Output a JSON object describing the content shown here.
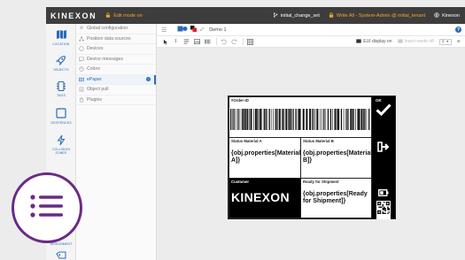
{
  "topbar": {
    "logo": "KINEXON",
    "edit_mode": "Edit mode on",
    "branch": "initial_change_set",
    "write_access": "Write All - System-Admin @ initial_tenant",
    "user": "Kinexon"
  },
  "iconnav": {
    "items": [
      {
        "label": "LOCATION",
        "icon": "map-icon",
        "active": true
      },
      {
        "label": "OBJECTS",
        "icon": "rocket-icon",
        "active": false
      },
      {
        "label": "TAGS",
        "icon": "chip-icon",
        "active": false
      },
      {
        "label": "GEOFENCES",
        "icon": "square-icon",
        "active": false
      },
      {
        "label": "COLLISION ZONES",
        "icon": "bolt-icon",
        "active": false
      },
      {
        "label": "ASSIGNMENT",
        "icon": "assignment-icon",
        "active": false
      }
    ]
  },
  "tree": {
    "items": [
      {
        "label": "Global configuration",
        "icon": "gear-icon",
        "active": false
      },
      {
        "label": "Position data sources",
        "icon": "network-icon",
        "active": false
      },
      {
        "label": "Devices",
        "icon": "circle-icon",
        "active": false
      },
      {
        "label": "Device messages",
        "icon": "message-icon",
        "active": false
      },
      {
        "label": "Colors",
        "icon": "palette-icon",
        "active": false
      },
      {
        "label": "ePaper",
        "icon": "epaper-icon",
        "active": true
      },
      {
        "label": "Object pull",
        "icon": "pull-icon",
        "active": false
      },
      {
        "label": "Plugins",
        "icon": "plugin-icon",
        "active": false
      }
    ],
    "help_glyph": "?"
  },
  "editor": {
    "doc_title": "Demo 1",
    "help_glyph": "?"
  },
  "toolbar": {
    "eui_display": "EUI display on",
    "insert_mode": "Insert mode off",
    "zoom": "1",
    "add_glyph": "+"
  },
  "label": {
    "order_title": "#Order-ID",
    "status_a_title": "Status Material A",
    "status_a_value": "{obj.properties[Material A]}",
    "status_b_title": "Status Material B",
    "status_b_value": "{obj.properties[Material B]}",
    "customer_title": "Customer",
    "customer_value": "KINEXON",
    "ready_title": "Ready for Shipment",
    "ready_value": "{obj.properties[Ready for Shipment]}",
    "side_top": "OK"
  },
  "colors": {
    "topbar_bg": "#3d3d3d",
    "accent_blue": "#2a6bb8",
    "edit_orange": "#f5a623",
    "menu_purple": "#6b2a86"
  }
}
